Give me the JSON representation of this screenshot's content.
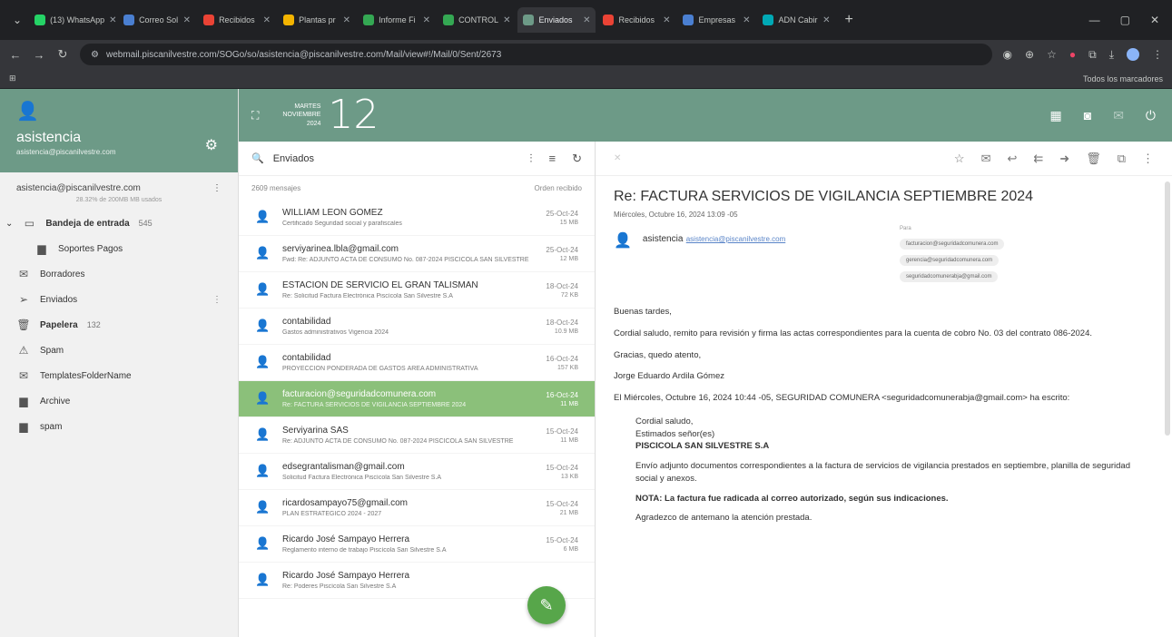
{
  "browser": {
    "tabs": [
      {
        "label": "(13) WhatsApp",
        "color": "#25d366"
      },
      {
        "label": "Correo Sol",
        "color": "#4a7fd1"
      },
      {
        "label": "Recibidos",
        "color": "#ea4335"
      },
      {
        "label": "Plantas pr",
        "color": "#f4b400"
      },
      {
        "label": "Informe Fi",
        "color": "#34a853"
      },
      {
        "label": "CONTROL",
        "color": "#34a853"
      },
      {
        "label": "Enviados",
        "color": "#6d9a87",
        "active": true
      },
      {
        "label": "Recibidos",
        "color": "#ea4335"
      },
      {
        "label": "Empresas",
        "color": "#4a7fd1"
      },
      {
        "label": "ADN Cabir",
        "color": "#00a9b5"
      }
    ],
    "url": "webmail.piscanilvestre.com/SOGo/so/asistencia@piscanilvestre.com/Mail/view#!/Mail/0/Sent/2673",
    "bookmarks_label": "Todos los marcadores"
  },
  "calendar": {
    "weekday": "MARTES",
    "month": "NOVIEMBRE",
    "year": "2024",
    "day": "12"
  },
  "account": {
    "name": "asistencia",
    "email": "asistencia@piscanilvestre.com",
    "row_email": "asistencia@piscanilvestre.com",
    "quota": "28.32% de 200MB MB usados"
  },
  "folders": [
    {
      "label": "Bandeja de entrada",
      "count": "545",
      "icon": "inbox-icon",
      "glyph": "▭",
      "bold": true,
      "expand": true
    },
    {
      "label": "Soportes Pagos",
      "count": "",
      "icon": "folder-icon",
      "glyph": "▆",
      "sub": true
    },
    {
      "label": "Borradores",
      "count": "",
      "icon": "drafts-icon",
      "glyph": "✉"
    },
    {
      "label": "Enviados",
      "count": "",
      "icon": "send-icon",
      "glyph": "➢",
      "menu": true
    },
    {
      "label": "Papelera",
      "count": "132",
      "icon": "trash-icon",
      "glyph": "🗑",
      "bold": true
    },
    {
      "label": "Spam",
      "count": "",
      "icon": "spam-icon",
      "glyph": "⚠"
    },
    {
      "label": "TemplatesFolderName",
      "count": "",
      "icon": "templates-icon",
      "glyph": "✉"
    },
    {
      "label": "Archive",
      "count": "",
      "icon": "folder-icon",
      "glyph": "▆"
    },
    {
      "label": "spam",
      "count": "",
      "icon": "folder-icon",
      "glyph": "▆"
    }
  ],
  "list": {
    "folder": "Enviados",
    "count": "2609 mensajes",
    "sort": "Orden recibido",
    "messages": [
      {
        "from": "WILLIAM LEON GOMEZ",
        "subject": "Certificado Seguridad social y parafiscales",
        "date": "25-Oct-24",
        "size": "15 MB"
      },
      {
        "from": "serviyarinea.lbla@gmail.com",
        "subject": "Fwd: Re: ADJUNTO ACTA DE CONSUMO No. 087-2024 PISCICOLA SAN SILVESTRE",
        "date": "25-Oct-24",
        "size": "12 MB"
      },
      {
        "from": "ESTACION DE SERVICIO EL GRAN TALISMAN",
        "subject": "Re: Solicitud Factura Electrónica Piscícola San Silvestre S.A",
        "date": "18-Oct-24",
        "size": "72 KB"
      },
      {
        "from": "contabilidad",
        "subject": "Gastos administrativos Vigencia 2024",
        "date": "18-Oct-24",
        "size": "10.9 MB"
      },
      {
        "from": "contabilidad",
        "subject": "PROYECCIÓN PONDERADA DE GASTOS ÁREA ADMINISTRATIVA",
        "date": "16-Oct-24",
        "size": "157 KB"
      },
      {
        "from": "facturacion@seguridadcomunera.com",
        "subject": "Re: FACTURA SERVICIOS DE VIGILANCIA SEPTIEMBRE 2024",
        "date": "16-Oct-24",
        "size": "11 MB",
        "selected": true
      },
      {
        "from": "Serviyarina SAS",
        "subject": "Re: ADJUNTO ACTA DE CONSUMO No. 087-2024 PISCICOLA SAN SILVESTRE",
        "date": "15-Oct-24",
        "size": "11 MB"
      },
      {
        "from": "edsegrantalisman@gmail.com",
        "subject": "Solicitud Factura Electrónica Piscícola San Silvestre S.A",
        "date": "15-Oct-24",
        "size": "13 KB"
      },
      {
        "from": "ricardosampayo75@gmail.com",
        "subject": "PLAN ESTRATÉGICO 2024 - 2027",
        "date": "15-Oct-24",
        "size": "21 MB"
      },
      {
        "from": "Ricardo José Sampayo Herrera",
        "subject": "Reglamento interno de trabajo Piscícola San Silvestre S.A",
        "date": "15-Oct-24",
        "size": "6 MB"
      },
      {
        "from": "Ricardo José Sampayo Herrera",
        "subject": "Re: Poderes Piscícola San Silvestre S.A",
        "date": "",
        "size": ""
      }
    ]
  },
  "reader": {
    "subject": "Re: FACTURA SERVICIOS DE VIGILANCIA SEPTIEMBRE 2024",
    "date": "Miércoles, Octubre 16, 2024 13:09 -05",
    "from_name": "asistencia",
    "from_email": "asistencia@piscanilvestre.com",
    "to_label": "Para",
    "recipients": [
      "facturacion@seguridadcomunera.com",
      "gerencia@seguridadcomunera.com",
      "seguridadcomunerabja@gmail.com"
    ],
    "body": [
      "Buenas tardes,",
      "Cordial saludo, remito para revisión y firma las actas correspondientes para la cuenta de cobro No. 03 del contrato 086-2024.",
      "Gracias, quedo atento,",
      "Jorge Eduardo Ardila Gómez",
      "El Miércoles, Octubre 16, 2024 10:44 -05, SEGURIDAD COMUNERA <seguridadcomunerabja@gmail.com> ha escrito:"
    ],
    "quote": {
      "greeting": "Cordial saludo,",
      "to": "Estimados señor(es)",
      "company": "PISCICOLA SAN SILVESTRE S.A",
      "p1": "Envío adjunto documentos correspondientes a la factura de servicios de vigilancia prestados en septiembre, planilla de seguridad social y anexos.",
      "note": "NOTA: La factura fue radicada al correo autorizado, según sus indicaciones.",
      "thanks": "Agradezco de antemano la atención prestada."
    }
  }
}
